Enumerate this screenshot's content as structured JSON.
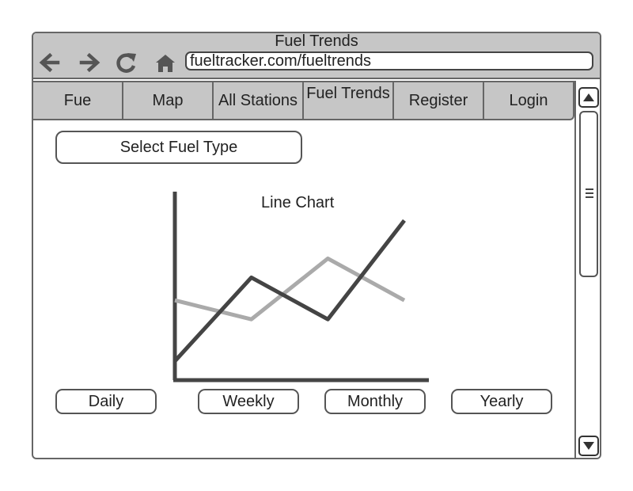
{
  "window": {
    "title": "Fuel Trends",
    "url": "fueltracker.com/fueltrends",
    "nav": [
      "back-arrow",
      "forward-arrow",
      "reload",
      "home"
    ]
  },
  "tabs": [
    {
      "label": "Fue"
    },
    {
      "label": "Map"
    },
    {
      "label": "All Stations"
    },
    {
      "label": "Fuel Trends"
    },
    {
      "label": "Register"
    },
    {
      "label": "Login"
    }
  ],
  "main": {
    "select_label": "Select Fuel Type",
    "periods": [
      "Daily",
      "Weekly",
      "Monthly",
      "Yearly"
    ]
  },
  "chart_data": {
    "type": "line",
    "title": "Line Chart",
    "x": [
      0,
      1,
      2,
      3
    ],
    "series": [
      {
        "color": "#aaaaaa",
        "values": [
          4.2,
          3.2,
          6.4,
          4.2
        ]
      },
      {
        "color": "#444444",
        "values": [
          1.0,
          5.4,
          3.2,
          8.4
        ]
      }
    ],
    "ylim": [
      0,
      10
    ],
    "xlim": [
      0,
      3.0
    ],
    "colors": {
      "axis": "#444444"
    }
  },
  "colors": {
    "chrome": "#c6c6c6",
    "border": "#666666"
  }
}
